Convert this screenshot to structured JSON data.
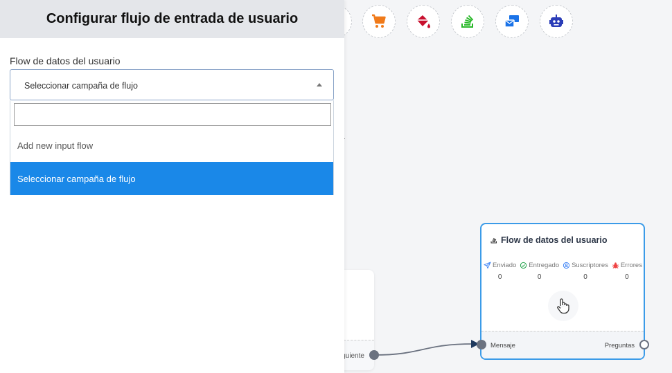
{
  "panel": {
    "title": "Configurar flujo de entrada de usuario",
    "field_label": "Flow de datos del usuario",
    "select_value": "Seleccionar campaña de flujo",
    "search_placeholder": "",
    "options": [
      "Add new input flow",
      "Seleccionar campaña de flujo"
    ]
  },
  "toolbar": {
    "icons": [
      "cart-icon",
      "paint-bucket-icon",
      "stack-icon",
      "mail-flow-icon",
      "robot-icon"
    ],
    "colors": [
      "#f07a1a",
      "#c8102e",
      "#28b828",
      "#1a73e8",
      "#2b3db8"
    ]
  },
  "node": {
    "title": "Flow de datos del usuario",
    "stats": [
      {
        "label": "Enviado",
        "value": "0",
        "color": "#3b82f6"
      },
      {
        "label": "Entregado",
        "value": "0",
        "color": "#22a34a"
      },
      {
        "label": "Suscriptores",
        "value": "0",
        "color": "#3b82f6"
      },
      {
        "label": "Errores",
        "value": "0",
        "color": "#ef4444"
      }
    ],
    "input_label": "Mensaje",
    "output_label": "Preguntas"
  },
  "left_node": {
    "footer_label": "iguiente"
  }
}
